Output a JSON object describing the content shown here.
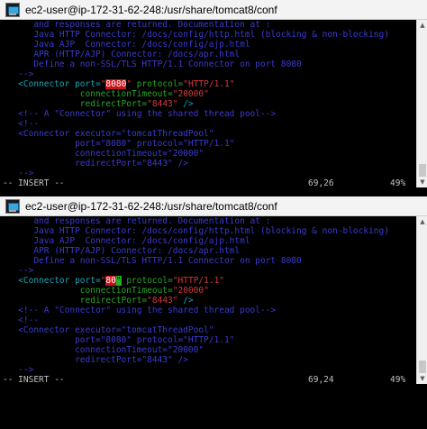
{
  "colors": {
    "comment": "#3a3ad0",
    "tag": "#1aa3b8",
    "attr": "#27a827",
    "string": "#d23a3a",
    "highlight": "#c8121a",
    "cursor": "#22b022"
  },
  "win1": {
    "title": "ec2-user@ip-172-31-62-248:/usr/share/tomcat8/conf",
    "comment_lines": [
      "      and responses are returned. Documentation at :",
      "      Java HTTP Connector: /docs/config/http.html (blocking & non-blocking)",
      "      Java AJP  Connector: /docs/config/ajp.html",
      "      APR (HTTP/AJP) Connector: /docs/apr.html",
      "      Define a non-SSL/TLS HTTP/1.1 Connector on port 8080",
      "   -->"
    ],
    "connector": {
      "open": "<Connector port=",
      "port_quote_open": "\"",
      "port_value": "8080",
      "port_quote_close": "\"",
      "protocol_attr": " protocol=",
      "protocol_value": "\"HTTP/1.1\"",
      "timeout_attr": "connectionTimeout=",
      "timeout_value": "\"20000\"",
      "redirect_attr": "redirectPort=",
      "redirect_value": "\"8443\"",
      "close": " />"
    },
    "tail_lines": [
      "   <!-- A \"Connector\" using the shared thread pool-->",
      "   <!--",
      "   <Connector executor=\"tomcatThreadPool\"",
      "              port=\"8080\" protocol=\"HTTP/1.1\"",
      "              connectionTimeout=\"20000\"",
      "              redirectPort=\"8443\" />",
      "   -->"
    ],
    "status": {
      "mode": "-- INSERT --",
      "position": "69,26",
      "percent": "49%"
    }
  },
  "win2": {
    "title": "ec2-user@ip-172-31-62-248:/usr/share/tomcat8/conf",
    "comment_lines": [
      "      and responses are returned. Documentation at :",
      "      Java HTTP Connector: /docs/config/http.html (blocking & non-blocking)",
      "      Java AJP  Connector: /docs/config/ajp.html",
      "      APR (HTTP/AJP) Connector: /docs/apr.html",
      "      Define a non-SSL/TLS HTTP/1.1 Connector on port 8080",
      "   -->"
    ],
    "connector": {
      "open": "<Connector port=",
      "port_quote_open": "\"",
      "port_value": "80",
      "port_quote_close": "\"",
      "protocol_attr": " protocol=",
      "protocol_value": "\"HTTP/1.1\"",
      "timeout_attr": "connectionTimeout=",
      "timeout_value": "\"20000\"",
      "redirect_attr": "redirectPort=",
      "redirect_value": "\"8443\"",
      "close": " />"
    },
    "tail_lines": [
      "   <!-- A \"Connector\" using the shared thread pool-->",
      "   <!--",
      "   <Connector executor=\"tomcatThreadPool\"",
      "              port=\"8080\" protocol=\"HTTP/1.1\"",
      "              connectionTimeout=\"20000\"",
      "              redirectPort=\"8443\" />",
      "   -->"
    ],
    "status": {
      "mode": "-- INSERT --",
      "position": "69,24",
      "percent": "49%"
    }
  }
}
